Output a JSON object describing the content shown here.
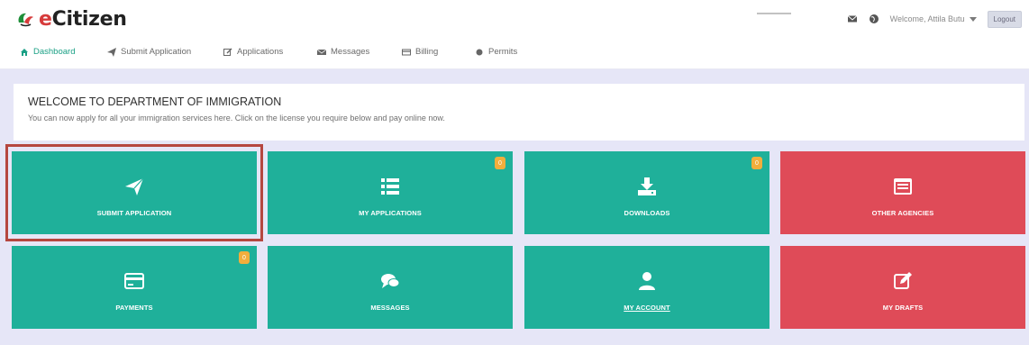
{
  "header": {
    "logo_text": "Citizen",
    "logo_e": "e",
    "welcome_text": "Welcome, Attila Butu",
    "logout_label": "Logout"
  },
  "nav": {
    "items": [
      {
        "label": "Dashboard",
        "icon": "home-icon"
      },
      {
        "label": "Submit Application",
        "icon": "send-icon"
      },
      {
        "label": "Applications",
        "icon": "edit-icon"
      },
      {
        "label": "Messages",
        "icon": "mail-icon"
      },
      {
        "label": "Billing",
        "icon": "card-icon"
      },
      {
        "label": "Permits",
        "icon": "circle-icon"
      }
    ]
  },
  "welcome": {
    "title": "WELCOME TO DEPARTMENT OF IMMIGRATION",
    "subtitle": "You can now apply for all your immigration services here. Click on the license you require below and pay online now."
  },
  "tiles": [
    {
      "label": "SUBMIT APPLICATION",
      "icon": "paper-plane-icon",
      "color": "#1fb09a"
    },
    {
      "label": "MY APPLICATIONS",
      "icon": "list-icon",
      "color": "#1fb09a",
      "badge": "0"
    },
    {
      "label": "DOWNLOADS",
      "icon": "download-icon",
      "color": "#1fb09a",
      "badge": "0"
    },
    {
      "label": "OTHER AGENCIES",
      "icon": "window-icon",
      "color": "#df4b58"
    },
    {
      "label": "PAYMENTS",
      "icon": "credit-card-icon",
      "color": "#1fb09a",
      "badge": "0"
    },
    {
      "label": "MESSAGES",
      "icon": "chat-icon",
      "color": "#1fb09a"
    },
    {
      "label": "MY ACCOUNT",
      "icon": "user-icon",
      "color": "#1fb09a"
    },
    {
      "label": "MY DRAFTS",
      "icon": "pencil-square-icon",
      "color": "#df4b58"
    }
  ],
  "colors": {
    "accent": "#1aa085",
    "tile_green": "#1fb09a",
    "tile_red": "#df4b58",
    "badge": "#f2ae3c",
    "highlight": "#b5473f"
  }
}
